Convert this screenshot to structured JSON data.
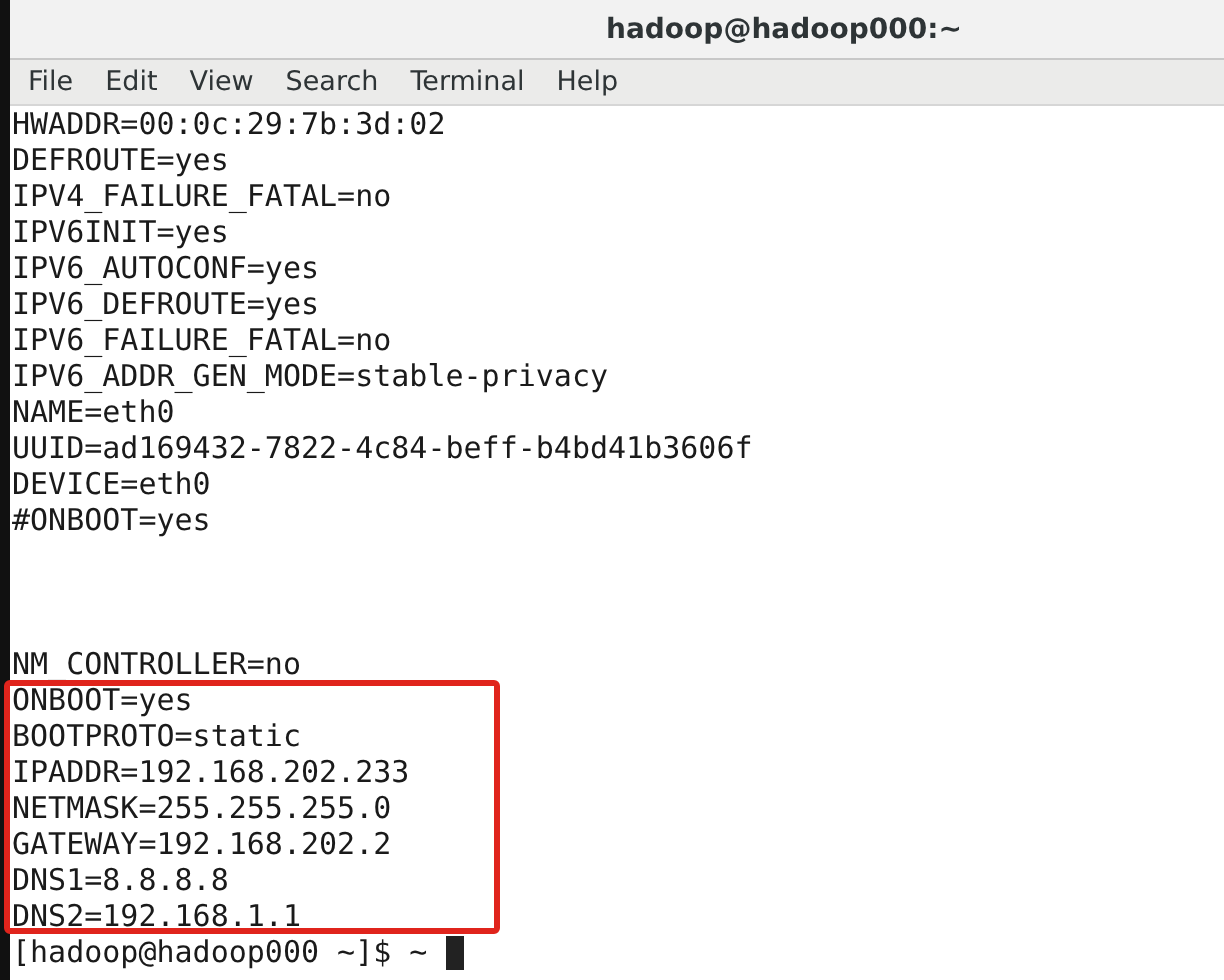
{
  "window": {
    "title": "hadoop@hadoop000:~"
  },
  "menu": [
    {
      "label": "File"
    },
    {
      "label": "Edit"
    },
    {
      "label": "View"
    },
    {
      "label": "Search"
    },
    {
      "label": "Terminal"
    },
    {
      "label": "Help"
    }
  ],
  "terminal": {
    "lines": [
      {
        "kind": "text",
        "text": "HWADDR=00:0c:29:7b:3d:02"
      },
      {
        "kind": "text",
        "text": "DEFROUTE=yes"
      },
      {
        "kind": "text",
        "text": "IPV4_FAILURE_FATAL=no"
      },
      {
        "kind": "text",
        "text": "IPV6INIT=yes"
      },
      {
        "kind": "text",
        "text": "IPV6_AUTOCONF=yes"
      },
      {
        "kind": "text",
        "text": "IPV6_DEFROUTE=yes"
      },
      {
        "kind": "text",
        "text": "IPV6_FAILURE_FATAL=no"
      },
      {
        "kind": "text",
        "text": "IPV6_ADDR_GEN_MODE=stable-privacy"
      },
      {
        "kind": "text",
        "text": "NAME=eth0"
      },
      {
        "kind": "text",
        "text": "UUID=ad169432-7822-4c84-beff-b4bd41b3606f"
      },
      {
        "kind": "text",
        "text": "DEVICE=eth0"
      },
      {
        "kind": "text",
        "text": "#ONBOOT=yes"
      },
      {
        "kind": "blank"
      },
      {
        "kind": "blank"
      },
      {
        "kind": "blank"
      },
      {
        "kind": "text",
        "text": "NM_CONTROLLER=no"
      }
    ],
    "highlighted_lines": [
      "ONBOOT=yes",
      "BOOTPROTO=static",
      "IPADDR=192.168.202.233",
      "NETMASK=255.255.255.0",
      "GATEWAY=192.168.202.2",
      "DNS1=8.8.8.8",
      "DNS2=192.168.1.1"
    ],
    "prompt": "[hadoop@hadoop000 ~]$ ~"
  }
}
